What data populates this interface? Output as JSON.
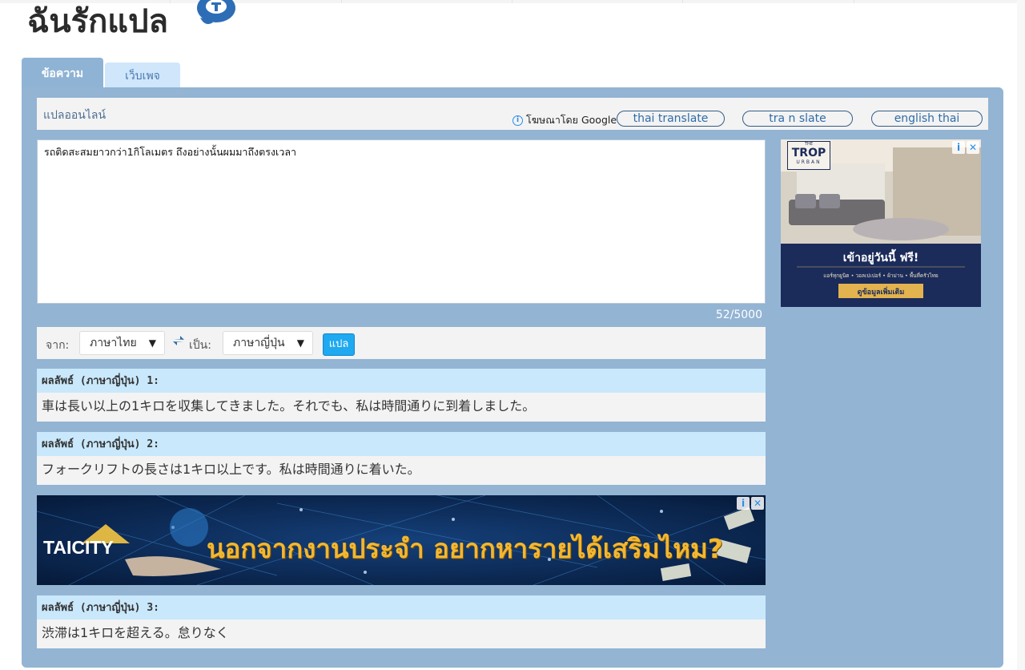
{
  "site": {
    "title": "ฉันรักแปล"
  },
  "tabs": [
    {
      "label": "ข้อความ",
      "active": true
    },
    {
      "label": "เว็บเพจ",
      "active": false
    }
  ],
  "online_bar": {
    "label": "แปลออนไลน์",
    "ads_by": "โฆษณาโดย Google",
    "keywords": [
      "thai translate",
      "tra n slate",
      "english thai"
    ]
  },
  "source": {
    "text": "รถติดสะสมยาวกว่า1กิโลเมตร ถึงอย่างนั้นผมมาถึงตรงเวลา",
    "char_count": "52/5000"
  },
  "controls": {
    "from_label": "จาก:",
    "from_value": "ภาษาไทย",
    "to_label": "เป็น:",
    "to_value": "ภาษาญี่ปุ่น",
    "translate_label": "แปล"
  },
  "results": [
    {
      "heading": "ผลลัพธ์ (ภาษาญี่ปุ่น) 1:",
      "text": "車は長い以上の1キロを収集してきました。それでも、私は時間通りに到着しました。"
    },
    {
      "heading": "ผลลัพธ์ (ภาษาญี่ปุ่น) 2:",
      "text": "フォークリフトの長さは1キロ以上です。私は時間通りに着いた。"
    },
    {
      "heading": "ผลลัพธ์ (ภาษาญี่ปุ่น) 3:",
      "text": "渋滞は1キロを超える。怠りなく"
    }
  ],
  "banner_ad": {
    "brand": "TAICITY",
    "headline": "นอกจากงานประจำ อยากหารายได้เสริมไหม?"
  },
  "side_ad": {
    "brand_small": "THE",
    "brand": "TROP",
    "brand_sub": "URBAN",
    "headline": "เข้าอยู่วันนี้ ฟรี!",
    "features": "แอร์ทุกยูนิต • วอลเปเปอร์ • ผ้าม่าน • พื้นที่ครัวไทย",
    "cta": "ดูข้อมูลเพิ่มเติม"
  },
  "colors": {
    "panel": "#93b4d3",
    "result_head": "#c9e8fb",
    "translate_button": "#1fa9f0",
    "link": "#2f6ca8"
  }
}
